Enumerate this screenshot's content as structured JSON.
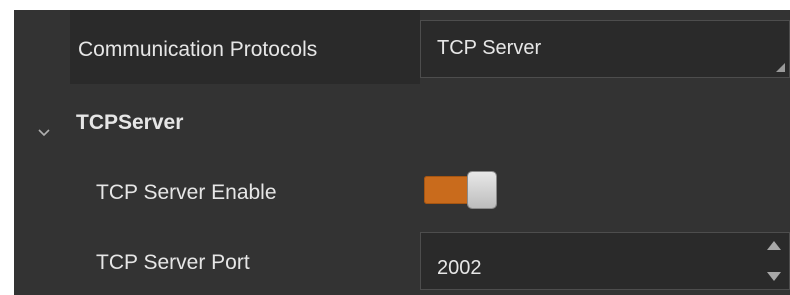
{
  "communication": {
    "label": "Communication Protocols",
    "value": "TCP Server"
  },
  "tcp_server_section": {
    "title": "TCPServer",
    "expanded": true,
    "enable_label": "TCP Server Enable",
    "enable_value": true,
    "port_label": "TCP Server Port",
    "port_value": "2002"
  },
  "colors": {
    "panel_bg": "#333333",
    "field_bg": "#2a2a2a",
    "accent": "#c96b1c",
    "text": "#e6e6e6"
  }
}
